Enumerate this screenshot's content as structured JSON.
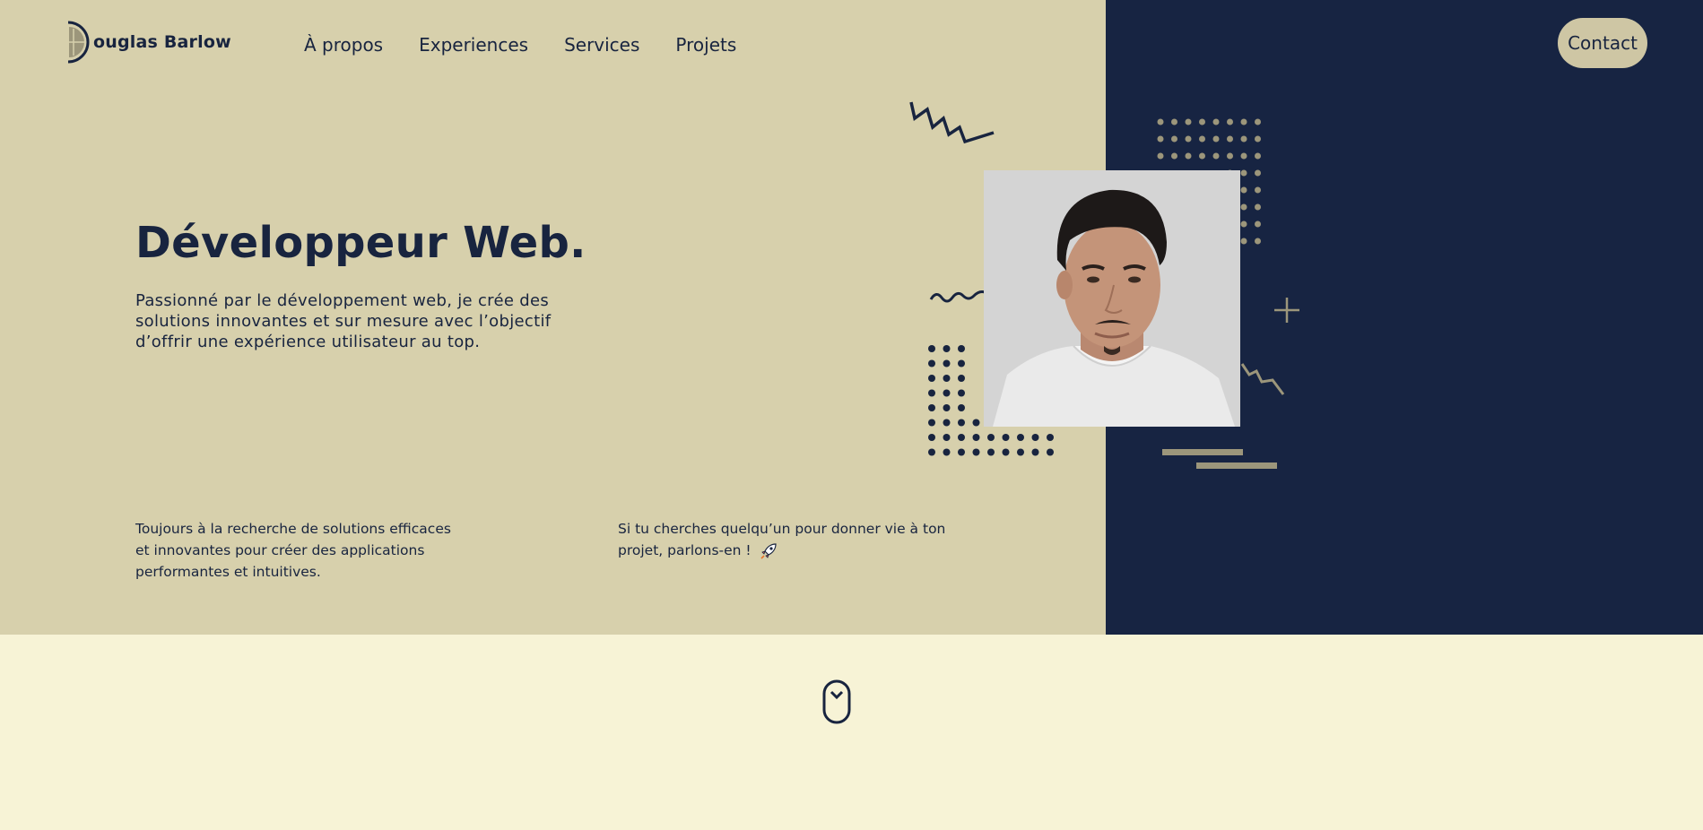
{
  "header": {
    "logo_text": "ouglas Barlow",
    "nav": [
      {
        "label": "À propos"
      },
      {
        "label": "Experiences"
      },
      {
        "label": "Services"
      },
      {
        "label": "Projets"
      }
    ],
    "contact_label": "Contact"
  },
  "hero": {
    "title": "Développeur Web.",
    "description": "Passionné par le développement web, je crée des solutions innovantes et sur mesure avec l’objectif d’offrir une expérience utilisateur au top.",
    "info_left": "Toujours à la recherche de solutions efficaces et innovantes pour créer des applications performantes et intuitives.",
    "info_right": "Si tu cherches quelqu’un pour donner vie à ton projet, parlons-en !"
  },
  "icons": {
    "logo": "half-circle-logo-icon",
    "rocket": "rocket-icon",
    "scroll": "mouse-scroll-icon"
  },
  "colors": {
    "beige": "#d7d0ac",
    "navy": "#172442",
    "cream": "#f7f3d6",
    "accent": "#cec6a4",
    "muted_accent": "#9c967b"
  }
}
